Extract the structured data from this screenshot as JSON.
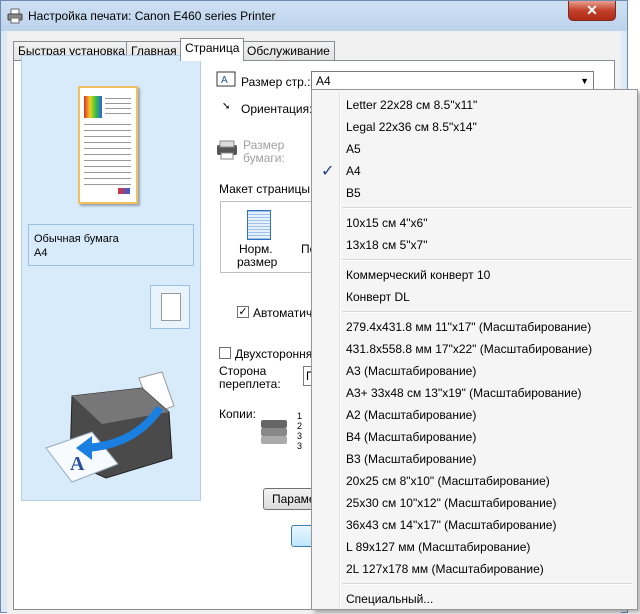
{
  "window": {
    "title": "Настройка печати: Canon E460 series Printer",
    "close_label": "✕"
  },
  "tabs": [
    {
      "label": "Быстрая установка"
    },
    {
      "label": "Главная"
    },
    {
      "label": "Страница"
    },
    {
      "label": "Обслуживание"
    }
  ],
  "preview": {
    "media_type": "Обычная бумага",
    "paper_size": "A4"
  },
  "page_setup": {
    "page_size_label": "Размер стр.:",
    "page_size_value": "A4",
    "orientation_label": "Ориентация:",
    "paper_size_label_line1": "Размер",
    "paper_size_label_line2": "бумаги:",
    "layout_label": "Макет страницы:",
    "layout_option_line1": "Норм.",
    "layout_option_line2": "размер",
    "layout_option2_partial": "По",
    "auto_label": "Автоматич.",
    "duplex_label": "Двухсторонняя",
    "binding_label_line1": "Сторона",
    "binding_label_line2": "переплета:",
    "binding_value": "П",
    "copies_label": "Копии:",
    "params_button": "Парамет"
  },
  "dropdown": {
    "group1": [
      "Letter 22x28 см 8.5\"x11\"",
      "Legal 22x36 см 8.5\"x14\"",
      "A5",
      "A4",
      "B5"
    ],
    "group2": [
      "10x15 см 4\"x6\"",
      "13x18 см 5\"x7\""
    ],
    "group3": [
      "Коммерческий конверт 10",
      "Конверт DL"
    ],
    "group4": [
      "279.4x431.8 мм 11\"x17\" (Масштабирование)",
      "431.8x558.8 мм 17\"x22\" (Масштабирование)",
      "A3 (Масштабирование)",
      "A3+ 33x48 см 13\"x19\" (Масштабирование)",
      "A2 (Масштабирование)",
      "B4 (Масштабирование)",
      "B3 (Масштабирование)",
      "20x25 см 8\"x10\" (Масштабирование)",
      "25x30 см 10\"x12\" (Масштабирование)",
      "36x43 см 14\"x17\" (Масштабирование)",
      "L 89x127 мм (Масштабирование)",
      "2L 127x178 мм (Масштабирование)"
    ],
    "group5": [
      "Специальный..."
    ],
    "checkmark": "✓"
  },
  "colors": {
    "accent": "#1c3e8a",
    "preview_bg": "#d7ebfb",
    "close": "#c2412b"
  }
}
